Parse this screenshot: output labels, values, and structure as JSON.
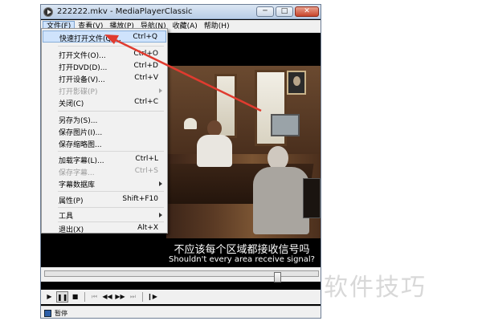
{
  "window": {
    "title": "222222.mkv - MediaPlayerClassic"
  },
  "title_buttons": {
    "minimize": "─",
    "maximize": "□",
    "close": "✕"
  },
  "menubar": [
    {
      "label": "文件(F)"
    },
    {
      "label": "查看(V)"
    },
    {
      "label": "播放(P)"
    },
    {
      "label": "导航(N)"
    },
    {
      "label": "收藏(A)"
    },
    {
      "label": "帮助(H)"
    }
  ],
  "file_menu": {
    "items": [
      {
        "label": "快速打开文件(Q)...",
        "shortcut": "Ctrl+Q",
        "highlight": true
      },
      {
        "label": "打开文件(O)...",
        "shortcut": "Ctrl+O"
      },
      {
        "label": "打开DVD(D)...",
        "shortcut": "Ctrl+D"
      },
      {
        "label": "打开设备(V)...",
        "shortcut": "Ctrl+V"
      },
      {
        "label": "打开影碟(P)",
        "shortcut": "",
        "disabled": true,
        "submenu": true
      },
      {
        "label": "关闭(C)",
        "shortcut": "Ctrl+C"
      },
      {
        "label": "另存为(S)...",
        "shortcut": ""
      },
      {
        "label": "保存图片(I)...",
        "shortcut": ""
      },
      {
        "label": "保存缩略图...",
        "shortcut": ""
      },
      {
        "label": "加载字幕(L)...",
        "shortcut": "Ctrl+L"
      },
      {
        "label": "保存字幕...",
        "shortcut": "Ctrl+S",
        "disabled": true
      },
      {
        "label": "字幕数据库",
        "shortcut": "",
        "submenu": true
      },
      {
        "label": "属性(P)",
        "shortcut": "Shift+F10"
      },
      {
        "label": "工具",
        "shortcut": "",
        "submenu": true
      },
      {
        "label": "退出(X)",
        "shortcut": "Alt+X"
      }
    ]
  },
  "subtitles": {
    "chinese": "不应该每个区域都接收信号吗",
    "english": "Shouldn't every area receive signal?"
  },
  "seek": {
    "position_fraction": 0.86
  },
  "controls": {
    "play": "▶",
    "pause": "❚❚",
    "stop": "■",
    "prev": "⏮",
    "rewind": "◀◀",
    "forward": "▶▶",
    "next": "⏭",
    "frame_step": "❙▶"
  },
  "status": {
    "text": "暂停"
  },
  "watermark": "软件技巧",
  "colors": {
    "highlight": "#cfe3fc",
    "annotation_arrow": "#e03b2f"
  }
}
